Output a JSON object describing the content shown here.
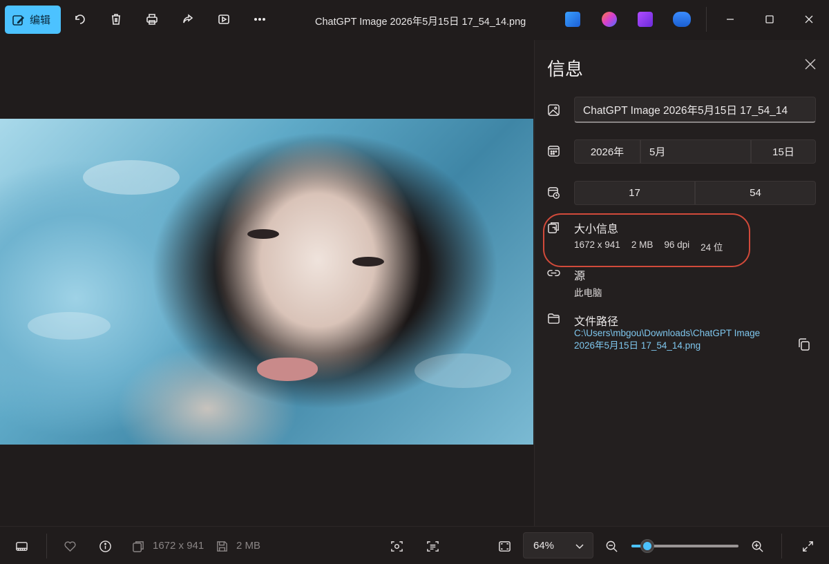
{
  "toolbar": {
    "edit_label": "编辑",
    "window_title": "ChatGPT Image 2026年5月15日 17_54_14.png",
    "icons": [
      "rotate-icon",
      "delete-icon",
      "print-icon",
      "share-icon",
      "slideshow-icon",
      "more-icon"
    ],
    "app_icons": [
      "photos-app-icon",
      "copilot-app-icon",
      "clipchamp-app-icon",
      "onedrive-app-icon"
    ]
  },
  "info_panel": {
    "title": "信息",
    "file_name": "ChatGPT Image 2026年5月15日 17_54_14",
    "date": {
      "year": "2026年",
      "month": "5月",
      "day": "15日"
    },
    "time": {
      "hour": "17",
      "minute": "54"
    },
    "size_section": {
      "title": "大小信息",
      "dimensions": "1672 x 941",
      "file_size": "2 MB",
      "dpi": "96 dpi",
      "bit_depth": "24 位"
    },
    "source_section": {
      "title": "源",
      "value": "此电脑"
    },
    "path_section": {
      "title": "文件路径",
      "path_line1": "C:\\Users\\mbgou\\Downloads\\ChatGPT Image",
      "path_line2": "2026年5月15日 17_54_14.png"
    },
    "highlight_color": "#d24a3a"
  },
  "statusbar": {
    "dimensions": "1672 x 941",
    "file_size": "2 MB",
    "zoom": "64%",
    "zoom_level": 0.15
  },
  "colors": {
    "accent": "#4cc2ff",
    "background": "#201c1c",
    "link": "#7fc7ee"
  }
}
